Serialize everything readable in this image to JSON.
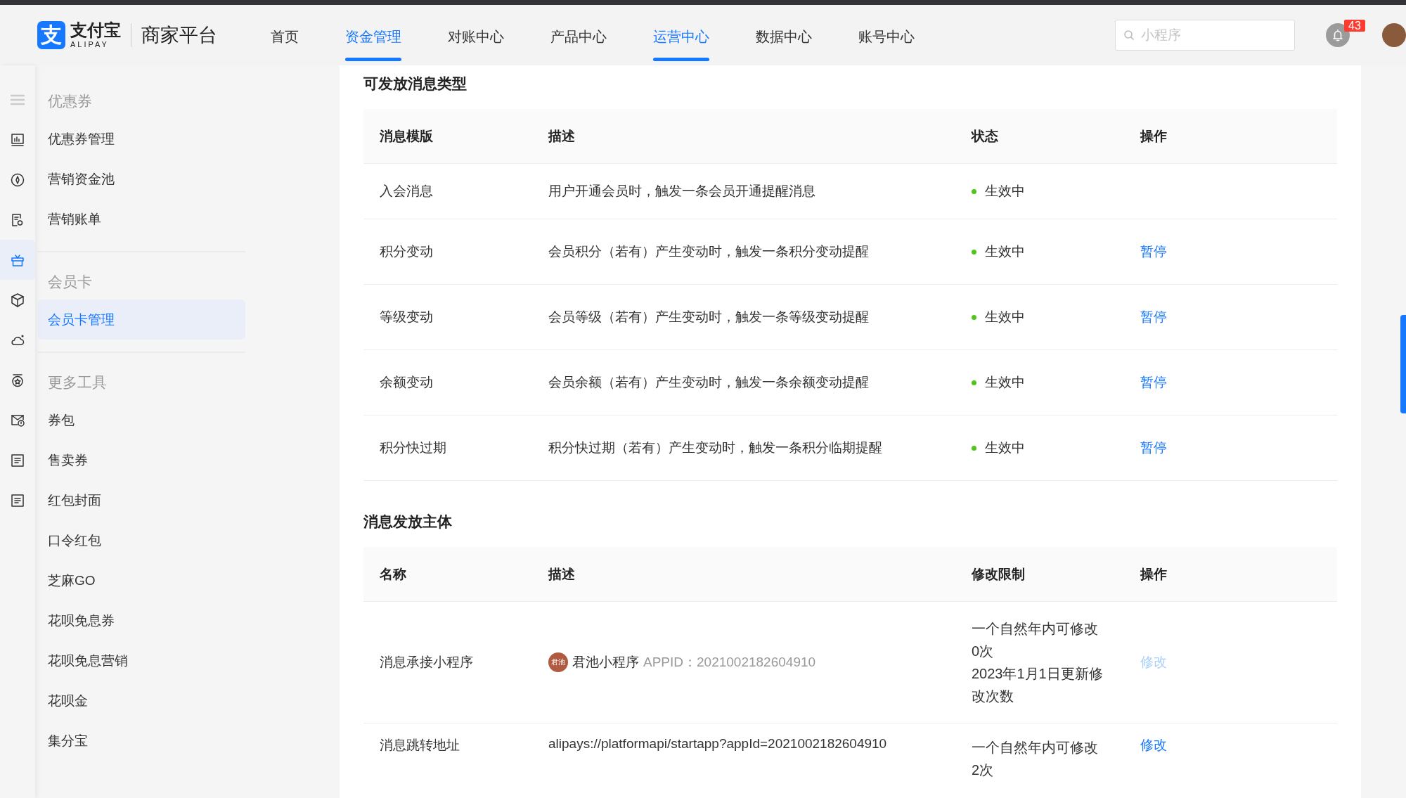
{
  "header": {
    "logo": {
      "mark": "支",
      "brand": "支付宝",
      "brand_latin": "ALIPAY",
      "platform": "商家平台"
    },
    "nav": [
      {
        "label": "首页",
        "selected": false
      },
      {
        "label": "资金管理",
        "selected": true
      },
      {
        "label": "对账中心",
        "selected": false
      },
      {
        "label": "产品中心",
        "selected": false
      },
      {
        "label": "运营中心",
        "selected": true
      },
      {
        "label": "数据中心",
        "selected": false
      },
      {
        "label": "账号中心",
        "selected": false
      }
    ],
    "search": {
      "placeholder": "小程序"
    },
    "notifications": {
      "count": "43"
    }
  },
  "icon_rail": [
    {
      "kind": "menu",
      "selected": false
    },
    {
      "kind": "chart",
      "selected": false
    },
    {
      "kind": "compass",
      "selected": false
    },
    {
      "kind": "document",
      "selected": false
    },
    {
      "kind": "gift",
      "selected": true
    },
    {
      "kind": "cube",
      "selected": false
    },
    {
      "kind": "cloud",
      "selected": false
    },
    {
      "kind": "medal",
      "selected": false
    },
    {
      "kind": "mail",
      "selected": false
    },
    {
      "kind": "list",
      "selected": false
    },
    {
      "kind": "list",
      "selected": false
    }
  ],
  "sidebar": {
    "groups": [
      {
        "title": "优惠券",
        "items": [
          {
            "label": "优惠券管理",
            "selected": false
          },
          {
            "label": "营销资金池",
            "selected": false
          },
          {
            "label": "营销账单",
            "selected": false
          }
        ]
      },
      {
        "title": "会员卡",
        "items": [
          {
            "label": "会员卡管理",
            "selected": true
          }
        ]
      },
      {
        "title": "更多工具",
        "items": [
          {
            "label": "券包",
            "selected": false
          },
          {
            "label": "售卖券",
            "selected": false
          },
          {
            "label": "红包封面",
            "selected": false
          },
          {
            "label": "口令红包",
            "selected": false
          },
          {
            "label": "芝麻GO",
            "selected": false
          },
          {
            "label": "花呗免息券",
            "selected": false
          },
          {
            "label": "花呗免息营销",
            "selected": false
          },
          {
            "label": "花呗金",
            "selected": false
          },
          {
            "label": "集分宝",
            "selected": false
          }
        ]
      }
    ]
  },
  "message_types": {
    "title": "可发放消息类型",
    "columns": [
      "消息模版",
      "描述",
      "状态",
      "操作"
    ],
    "rows": [
      {
        "template": "入会消息",
        "description": "用户开通会员时，触发一条会员开通提醒消息",
        "status": "生效中",
        "action": null
      },
      {
        "template": "积分变动",
        "description": "会员积分（若有）产生变动时，触发一条积分变动提醒",
        "status": "生效中",
        "action": "暂停"
      },
      {
        "template": "等级变动",
        "description": "会员等级（若有）产生变动时，触发一条等级变动提醒",
        "status": "生效中",
        "action": "暂停"
      },
      {
        "template": "余额变动",
        "description": "会员余额（若有）产生变动时，触发一条余额变动提醒",
        "status": "生效中",
        "action": "暂停"
      },
      {
        "template": "积分快过期",
        "description": "积分快过期（若有）产生变动时，触发一条积分临期提醒",
        "status": "生效中",
        "action": "暂停"
      }
    ]
  },
  "senders": {
    "title": "消息发放主体",
    "columns": [
      "名称",
      "描述",
      "修改限制",
      "操作"
    ],
    "rows": [
      {
        "name": "消息承接小程序",
        "description": {
          "kind": "app",
          "logo": "君池",
          "app_name": "君池小程序",
          "appid_label": "APPID：",
          "appid": "2021002182604910"
        },
        "limit": [
          "一个自然年内可修改0次",
          "2023年1月1日更新修改次数"
        ],
        "action": {
          "label": "修改",
          "disabled": true
        }
      },
      {
        "name": "消息跳转地址",
        "description": {
          "kind": "text",
          "text": "alipays://platformapi/startapp?appId=2021002182604910"
        },
        "limit": [
          "一个自然年内可修改2次"
        ],
        "action": {
          "label": "修改",
          "disabled": false
        }
      }
    ]
  }
}
